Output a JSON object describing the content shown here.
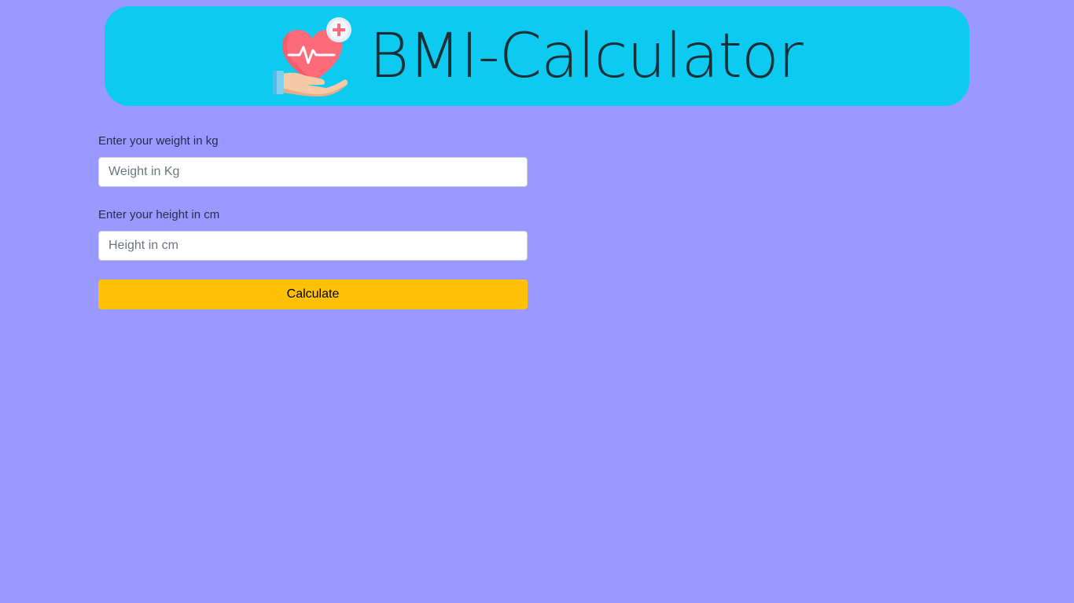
{
  "header": {
    "title": "BMI-Calculator",
    "logo_icon": "heart-in-hand-icon",
    "background": "#0dcaf0"
  },
  "form": {
    "weight": {
      "label": "Enter your weight in kg",
      "placeholder": "Weight in Kg",
      "value": ""
    },
    "height": {
      "label": "Enter your height in cm",
      "placeholder": "Height in cm",
      "value": ""
    },
    "submit_label": "Calculate"
  },
  "colors": {
    "page_background": "#9999ff",
    "header_background": "#0dcaf0",
    "button_background": "#ffc107"
  }
}
